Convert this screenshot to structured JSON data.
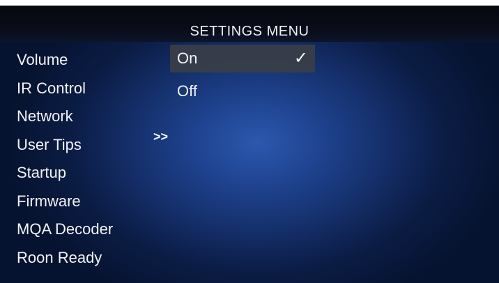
{
  "screen": {
    "title": "SETTINGS MENU"
  },
  "menu": {
    "items": [
      {
        "label": "Volume"
      },
      {
        "label": "IR Control"
      },
      {
        "label": "Network"
      },
      {
        "label": "User Tips"
      },
      {
        "label": "Startup"
      },
      {
        "label": "Firmware"
      },
      {
        "label": "MQA Decoder"
      },
      {
        "label": "Roon Ready"
      }
    ],
    "active_index": 3,
    "active_indicator": ">>"
  },
  "options": {
    "items": [
      {
        "label": "On",
        "selected": true,
        "check": "✓"
      },
      {
        "label": "Off",
        "selected": false
      }
    ]
  },
  "colors": {
    "background_center": "#2c58ad",
    "background_edge": "#061330",
    "highlight": "#3a3e48",
    "text": "#f2f3f5"
  }
}
